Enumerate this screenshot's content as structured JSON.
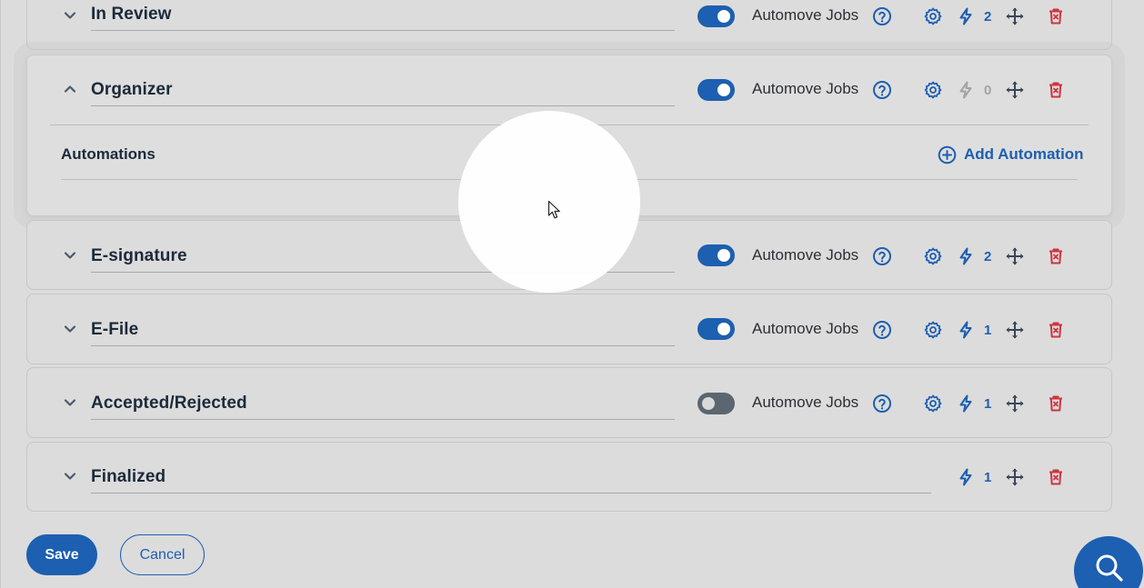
{
  "stages": [
    {
      "name": "In Review",
      "expanded": false,
      "automove_on": true,
      "automove_label": "Automove Jobs",
      "automation_count": "2",
      "has_settings": true
    },
    {
      "name": "Organizer",
      "expanded": true,
      "automove_on": true,
      "automove_label": "Automove Jobs",
      "automation_count": "0",
      "has_settings": true
    },
    {
      "name": "E-signature",
      "expanded": false,
      "automove_on": true,
      "automove_label": "Automove Jobs",
      "automation_count": "2",
      "has_settings": true
    },
    {
      "name": "E-File",
      "expanded": false,
      "automove_on": true,
      "automove_label": "Automove Jobs",
      "automation_count": "1",
      "has_settings": true
    },
    {
      "name": "Accepted/Rejected",
      "expanded": false,
      "automove_on": false,
      "automove_label": "Automove Jobs",
      "automation_count": "1",
      "has_settings": true
    },
    {
      "name": "Finalized",
      "expanded": false,
      "automove_on": null,
      "automove_label": "",
      "automation_count": "1",
      "has_settings": false
    }
  ],
  "organizer_panel": {
    "automations_title": "Automations",
    "add_automation_label": "Add Automation"
  },
  "footer": {
    "save_label": "Save",
    "cancel_label": "Cancel"
  },
  "icons": {
    "expand": "chevron-down-icon",
    "collapse": "chevron-up-icon",
    "help": "question-circle-icon",
    "settings": "gear-icon",
    "automation": "lightning-bolt-icon",
    "drag": "move-arrows-icon",
    "delete": "trash-icon",
    "add": "plus-circle-icon",
    "search": "search-icon"
  },
  "colors": {
    "accent": "#1d5fb0",
    "danger": "#d0343f",
    "muted": "#a3a3a3",
    "toggle_off": "#5c6670",
    "background": "#dcdcdc"
  }
}
